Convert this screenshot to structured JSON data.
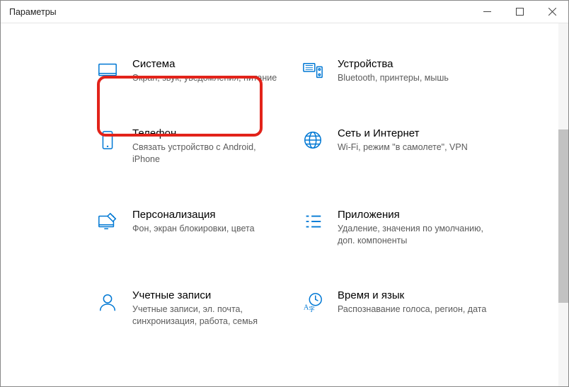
{
  "window": {
    "title": "Параметры"
  },
  "tiles": [
    {
      "title": "Система",
      "desc": "Экран, звук, уведомления, питание"
    },
    {
      "title": "Устройства",
      "desc": "Bluetooth, принтеры, мышь"
    },
    {
      "title": "Телефон",
      "desc": "Связать устройство с Android, iPhone"
    },
    {
      "title": "Сеть и Интернет",
      "desc": "Wi-Fi, режим \"в самолете\", VPN"
    },
    {
      "title": "Персонализация",
      "desc": "Фон, экран блокировки, цвета"
    },
    {
      "title": "Приложения",
      "desc": "Удаление, значения по умолчанию, доп. компоненты"
    },
    {
      "title": "Учетные записи",
      "desc": "Учетные записи, эл. почта, синхронизация, работа, семья"
    },
    {
      "title": "Время и язык",
      "desc": "Распознавание голоса, регион, дата"
    }
  ]
}
